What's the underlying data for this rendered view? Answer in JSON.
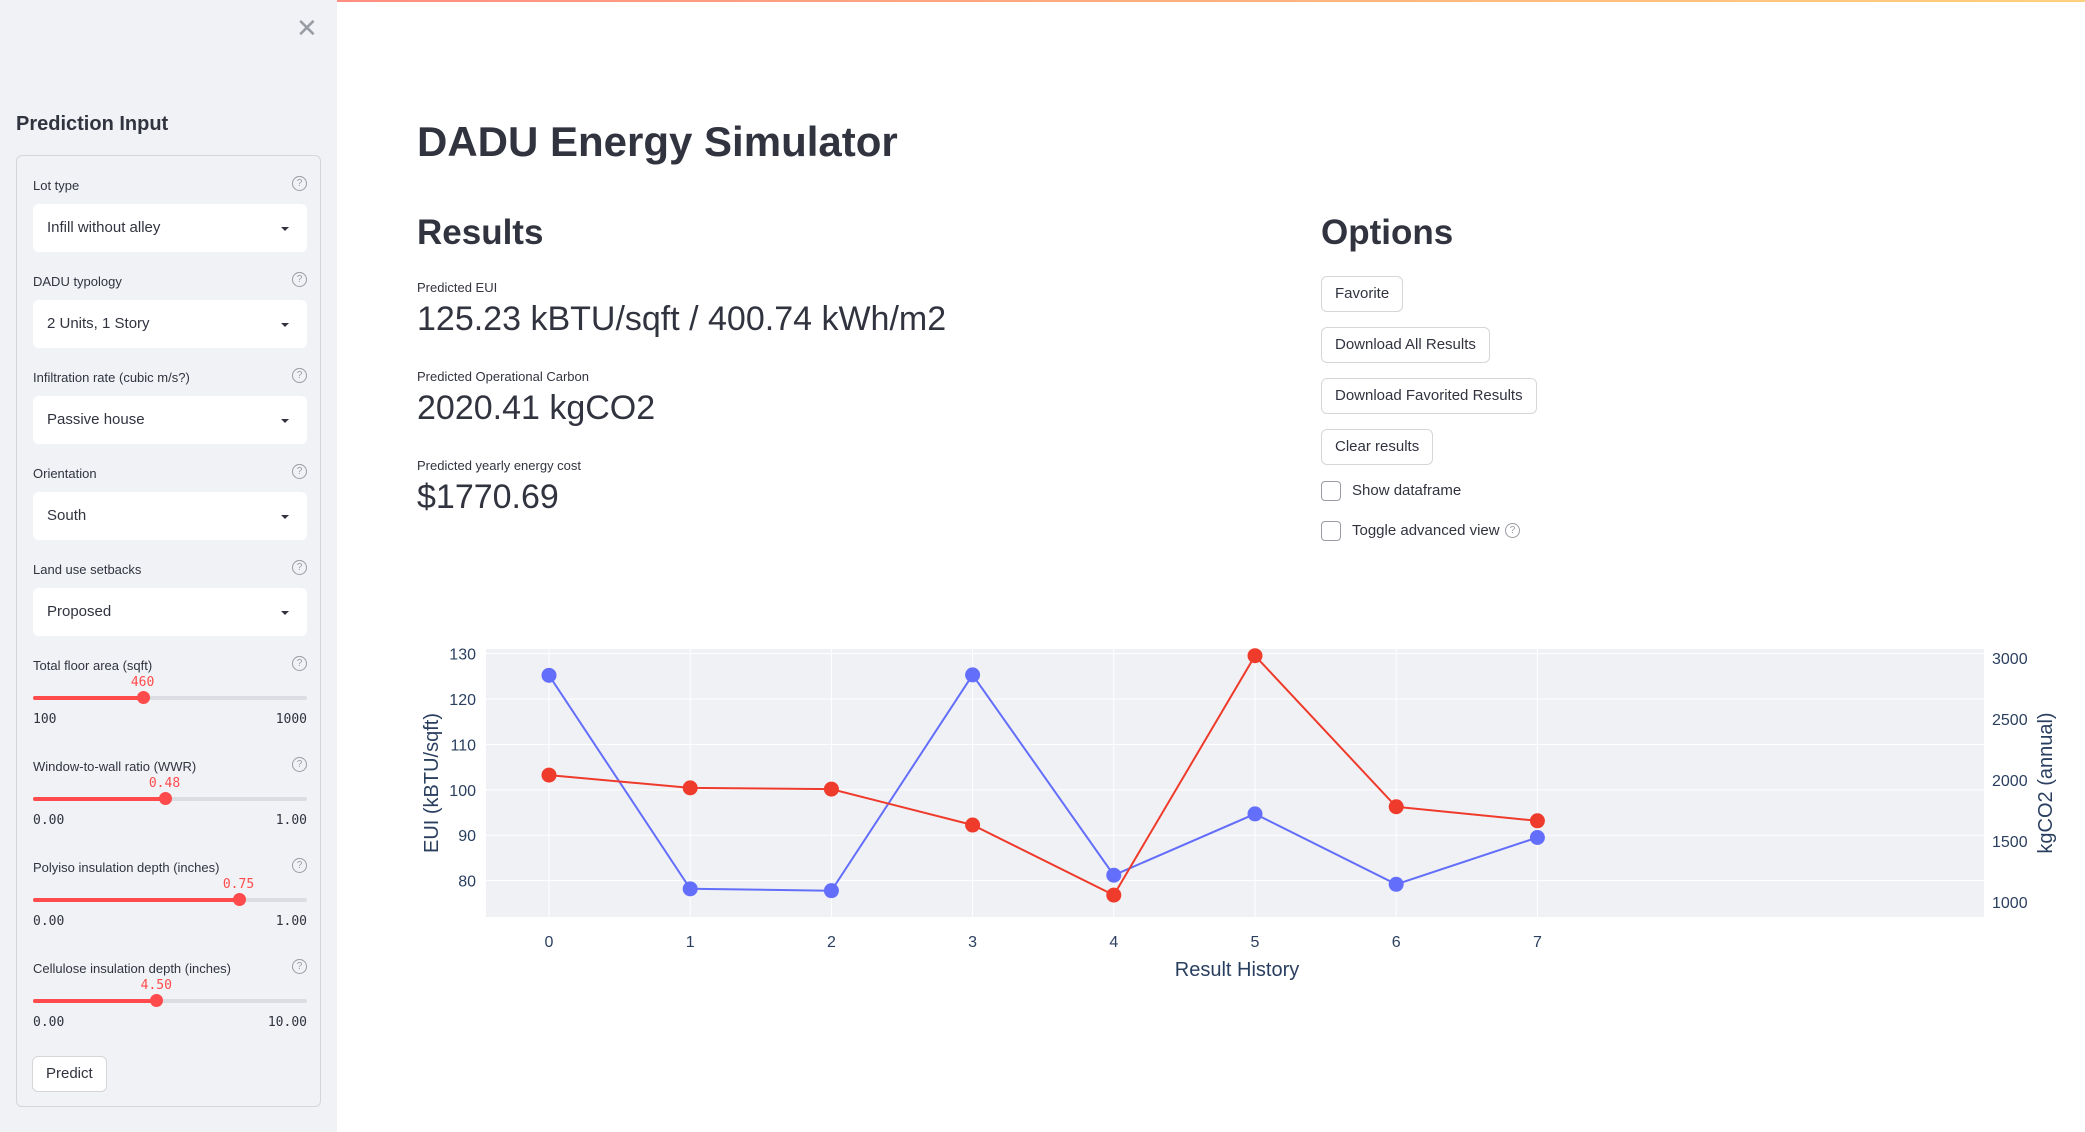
{
  "sidebar": {
    "close_icon": "close-icon",
    "title": "Prediction Input",
    "help_glyph": "?",
    "selects": [
      {
        "label": "Lot type",
        "value": "Infill without alley"
      },
      {
        "label": "DADU typology",
        "value": "2 Units, 1 Story"
      },
      {
        "label": "Infiltration rate (cubic m/s?)",
        "value": "Passive house"
      },
      {
        "label": "Orientation",
        "value": "South"
      },
      {
        "label": "Land use setbacks",
        "value": "Proposed"
      }
    ],
    "sliders": [
      {
        "label": "Total floor area (sqft)",
        "value": "460",
        "min": "100",
        "max": "1000",
        "fraction": 0.4
      },
      {
        "label": "Window-to-wall ratio (WWR)",
        "value": "0.48",
        "min": "0.00",
        "max": "1.00",
        "fraction": 0.48
      },
      {
        "label": "Polyiso insulation depth (inches)",
        "value": "0.75",
        "min": "0.00",
        "max": "1.00",
        "fraction": 0.75
      },
      {
        "label": "Cellulose insulation depth (inches)",
        "value": "4.50",
        "min": "0.00",
        "max": "10.00",
        "fraction": 0.45
      }
    ],
    "predict_label": "Predict"
  },
  "main": {
    "title": "DADU Energy Simulator",
    "results": {
      "heading": "Results",
      "metrics": [
        {
          "label": "Predicted EUI",
          "value": "125.23 kBTU/sqft / 400.74 kWh/m2"
        },
        {
          "label": "Predicted Operational Carbon",
          "value": "2020.41 kgCO2"
        },
        {
          "label": "Predicted yearly energy cost",
          "value": "$1770.69"
        }
      ]
    },
    "options": {
      "heading": "Options",
      "buttons": [
        "Favorite",
        "Download All Results",
        "Download Favorited Results",
        "Clear results"
      ],
      "checkboxes": [
        {
          "label": "Show dataframe",
          "checked": false
        },
        {
          "label": "Toggle advanced view",
          "checked": false,
          "help": true
        }
      ]
    }
  },
  "colors": {
    "accent": "#ff4b4b",
    "eui_series": "#636efa",
    "carbon_series": "#ef3b2c",
    "plot_bg": "#f0f1f5"
  },
  "chart_data": {
    "type": "line",
    "x": [
      0,
      1,
      2,
      3,
      4,
      5,
      6,
      7
    ],
    "xlabel": "Result History",
    "ylabel": "EUI (kBTU/sqft)",
    "y2label": "kgCO2 (annual)",
    "ylim": [
      72,
      131
    ],
    "y2lim": [
      875,
      3075
    ],
    "yticks": [
      80,
      90,
      100,
      110,
      120,
      130
    ],
    "y2ticks": [
      1000,
      1500,
      2000,
      2500,
      3000
    ],
    "grid": true,
    "series": [
      {
        "axis": "y",
        "color": "#636efa",
        "values": [
          125.2,
          78.2,
          77.8,
          125.3,
          81.2,
          94.7,
          79.2,
          89.5
        ]
      },
      {
        "axis": "y2",
        "color": "#ef3b2c",
        "values": [
          2040,
          1935,
          1925,
          1630,
          1055,
          3020,
          1780,
          1665
        ]
      }
    ]
  }
}
